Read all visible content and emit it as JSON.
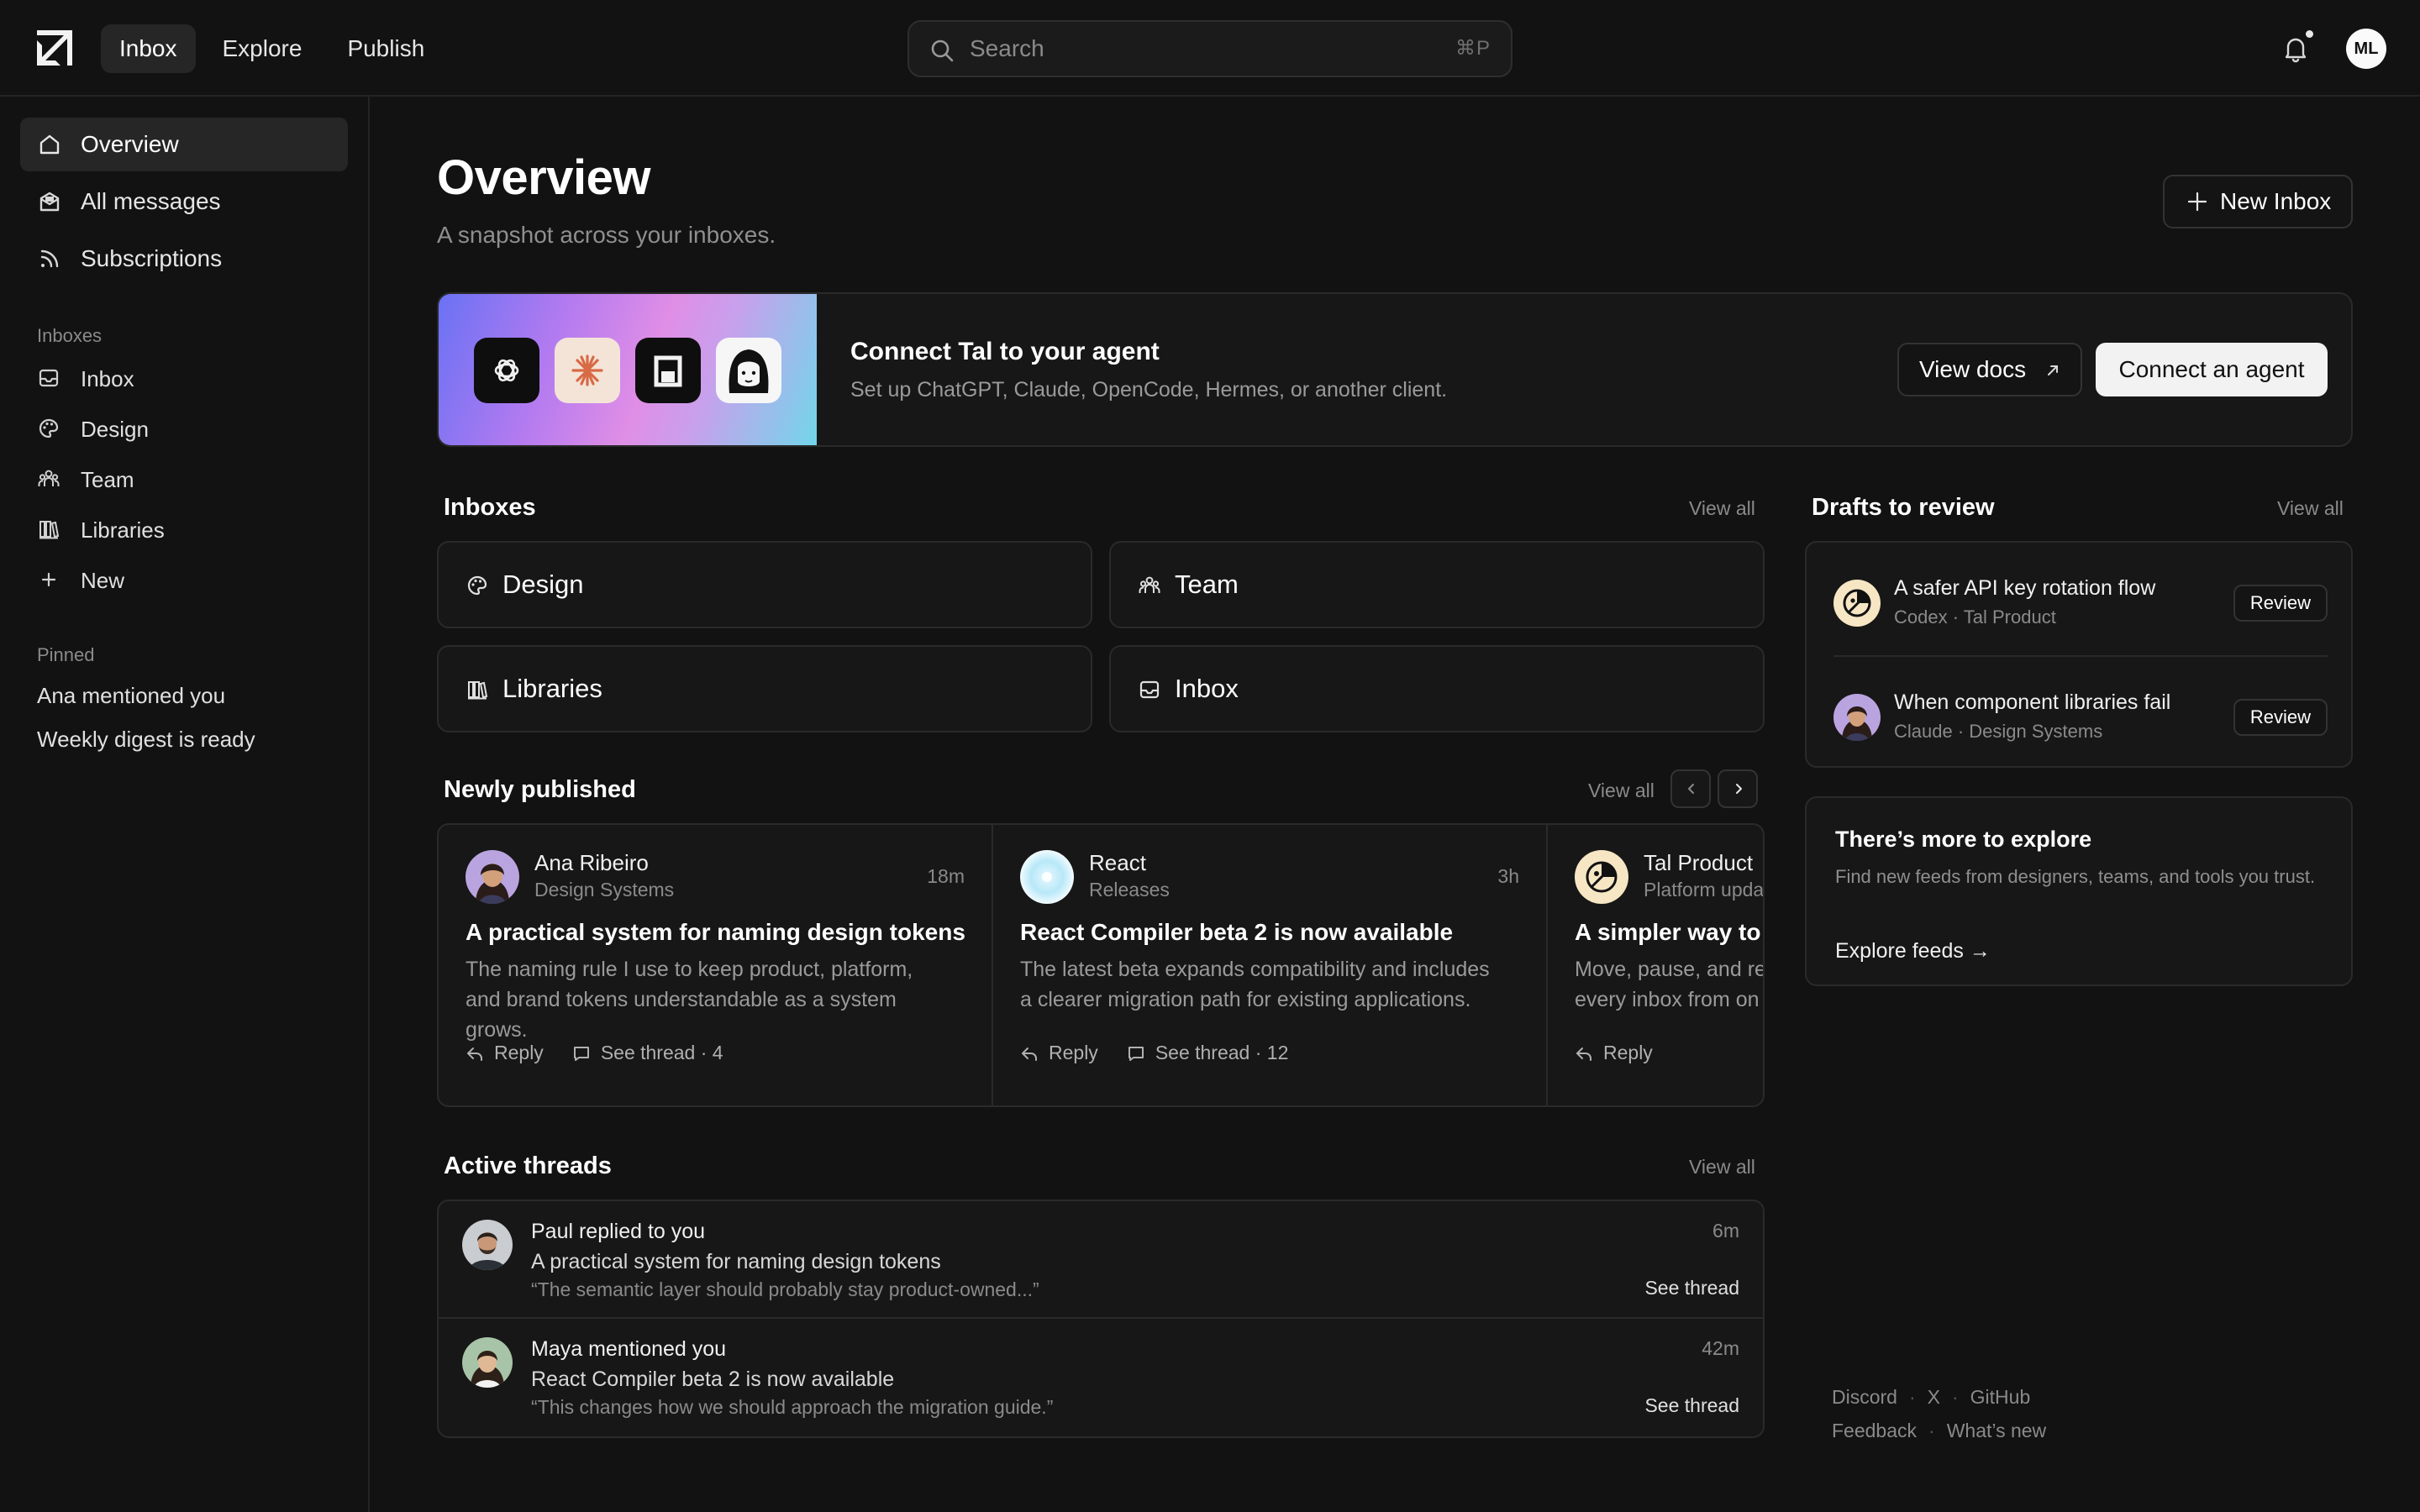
{
  "topbar": {
    "nav": [
      "Inbox",
      "Explore",
      "Publish"
    ],
    "search_placeholder": "Search",
    "search_shortcut": "⌘P",
    "avatar_initials": "ML"
  },
  "sidebar": {
    "main_items": [
      {
        "label": "Overview",
        "icon": "home-icon",
        "active": true
      },
      {
        "label": "All messages",
        "icon": "mailbox-icon"
      },
      {
        "label": "Subscriptions",
        "icon": "rss-icon"
      }
    ],
    "inboxes_heading": "Inboxes",
    "inboxes": [
      {
        "label": "Inbox",
        "icon": "inbox-icon"
      },
      {
        "label": "Design",
        "icon": "palette-icon"
      },
      {
        "label": "Team",
        "icon": "team-icon"
      },
      {
        "label": "Libraries",
        "icon": "library-icon"
      },
      {
        "label": "New",
        "icon": "plus-icon"
      }
    ],
    "pinned_heading": "Pinned",
    "pinned": [
      "Ana mentioned you",
      "Weekly digest is ready"
    ]
  },
  "main": {
    "title": "Overview",
    "subtitle": "A snapshot across your inboxes.",
    "new_inbox_label": "New Inbox",
    "banner": {
      "title": "Connect Tal to your agent",
      "text": "Set up ChatGPT, Claude, OpenCode, Hermes, or another client.",
      "view_docs_label": "View docs",
      "connect_label": "Connect an agent",
      "agents": [
        "openai-icon",
        "claude-icon",
        "opencode-icon",
        "hermes-icon"
      ]
    },
    "inboxes": {
      "title": "Inboxes",
      "view_all": "View all",
      "cards": [
        {
          "label": "Design",
          "icon": "palette-icon"
        },
        {
          "label": "Team",
          "icon": "team-icon"
        },
        {
          "label": "Libraries",
          "icon": "library-icon"
        },
        {
          "label": "Inbox",
          "icon": "inbox-icon"
        }
      ]
    },
    "newly_published": {
      "title": "Newly published",
      "view_all": "View all",
      "cards": [
        {
          "author": "Ana Ribeiro",
          "source": "Design Systems",
          "time": "18m",
          "title": "A practical system for naming design tokens",
          "excerpt": "The naming rule I use to keep product, platform, and brand tokens understandable as a system grows.",
          "reply": "Reply",
          "thread": "See thread · 4"
        },
        {
          "author": "React",
          "source": "Releases",
          "time": "3h",
          "title": "React Compiler beta 2 is now available",
          "excerpt": "The latest beta expands compatibility and includes a clearer migration path for existing applications.",
          "reply": "Reply",
          "thread": "See thread · 12"
        },
        {
          "author": "Tal Product",
          "source": "Platform upda",
          "time": "",
          "title": "A simpler way to m",
          "excerpt": "Move, pause, and re every inbox from on",
          "reply": "Reply",
          "thread": ""
        }
      ]
    },
    "active_threads": {
      "title": "Active threads",
      "view_all": "View all",
      "rows": [
        {
          "who": "Paul replied to you",
          "subject": "A practical system for naming design tokens",
          "quote": "“The semantic layer should probably stay product-owned...”",
          "time": "6m",
          "link": "See thread"
        },
        {
          "who": "Maya mentioned you",
          "subject": "React Compiler beta 2 is now available",
          "quote": "“This changes how we should approach the migration guide.”",
          "time": "42m",
          "link": "See thread"
        }
      ]
    }
  },
  "right": {
    "drafts": {
      "title": "Drafts to review",
      "view_all": "View all",
      "rows": [
        {
          "title": "A safer API key rotation flow",
          "meta": "Codex · Tal Product",
          "action": "Review"
        },
        {
          "title": "When component libraries fail",
          "meta": "Claude · Design Systems",
          "action": "Review"
        }
      ]
    },
    "explore": {
      "title": "There’s more to explore",
      "text": "Find new feeds from designers, teams, and tools you trust.",
      "link": "Explore feeds →"
    },
    "footer": {
      "row1": [
        "Discord",
        "X",
        "GitHub"
      ],
      "row2": [
        "Feedback",
        "What’s new"
      ],
      "separator": "·"
    }
  },
  "colors": {
    "background": "#121212",
    "surface": "#171717",
    "border": "#2a2a2a",
    "primary_button": "#f2f2f2"
  }
}
